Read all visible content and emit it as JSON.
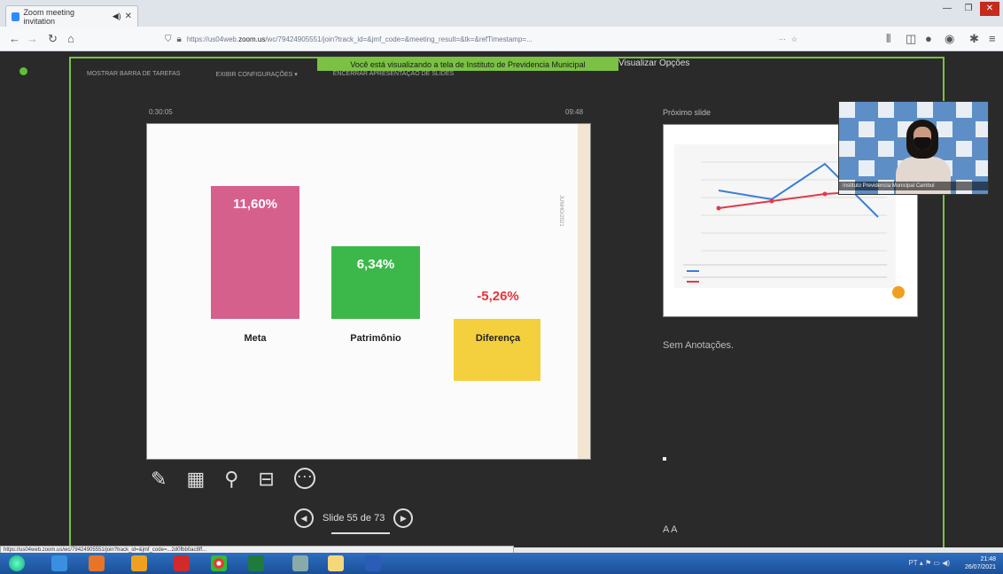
{
  "browser": {
    "tab_title": "Zoom meeting invitation",
    "tab_audio": "◀)",
    "tab_close": "✕",
    "url_prefix": "https://us04web.",
    "url_domain": "zoom.us",
    "url_rest": "/wc/79424905551/join?track_id=&jmf_code=&meeting_result=&tk=&refTimestamp=...",
    "more_icon": "···",
    "window_controls": [
      "—",
      "❐",
      "✕"
    ]
  },
  "zoom": {
    "banner": "Você está visualizando a tela de Instituto de Previdencia Municipal",
    "view_options": "Visualizar Opções",
    "menu": [
      "MOSTRAR BARRA DE TAREFAS",
      "EXIBIR CONFIGURAÇÕES ▾",
      "ENCERRAR APRESENTAÇÃO DE SLIDES"
    ],
    "timer": "0:30:05",
    "clock": "09:48",
    "next_slide_label": "Próximo slide",
    "notes": "Sem Anotações.",
    "slide_nav": "Slide 55 de 73",
    "font_controls": "A  A",
    "video_name": "Instituto Previdencia Municipal Cambuí"
  },
  "slide": {
    "bars": [
      {
        "label": "Meta",
        "value_text": "11,60%",
        "color": "#d6608c"
      },
      {
        "label": "Patrimônio",
        "value_text": "6,34%",
        "color": "#3cb84a"
      },
      {
        "label": "Diferença",
        "value_text": "-5,26%",
        "color": "#f4d03f",
        "value_color": "#e8333a"
      }
    ],
    "side_text": "JUNHO/2021"
  },
  "chart_data": {
    "type": "bar",
    "categories": [
      "Meta",
      "Patrimônio",
      "Diferença"
    ],
    "values": [
      11.6,
      6.34,
      -5.26
    ],
    "value_labels": [
      "11,60%",
      "6,34%",
      "-5,26%"
    ],
    "ylim": [
      0,
      12
    ]
  },
  "status_url": "https://us04web.zoom.us/wc/79424905551/join?track_id=&jmf_code=...2d0fbb0ac8ff...",
  "taskbar": {
    "time": "21:48",
    "date": "26/07/2021",
    "lang": "PT"
  }
}
